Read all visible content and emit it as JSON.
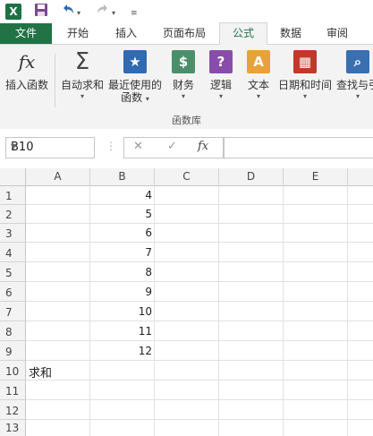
{
  "quick_access": {
    "app_icon": "X",
    "save_icon": "save-icon",
    "undo_icon": "undo-icon",
    "redo_icon": "redo-icon",
    "customize_icon": "customize-icon"
  },
  "tabs": [
    "文件",
    "开始",
    "插入",
    "页面布局",
    "公式",
    "数据",
    "审阅"
  ],
  "active_tab": "公式",
  "ribbon": {
    "insert_function": "插入函数",
    "autosum": "自动求和",
    "recent_line1": "最近使用的",
    "recent_line2": "函数",
    "financial": "财务",
    "logical": "逻辑",
    "text": "文本",
    "datetime": "日期和时间",
    "lookup": "查找与引",
    "group_label": "函数库"
  },
  "formula_bar": {
    "name_box": "B10",
    "fx_label": "fx",
    "formula": ""
  },
  "columns": [
    "A",
    "B",
    "C",
    "D",
    "E"
  ],
  "rows": [
    "1",
    "2",
    "3",
    "4",
    "5",
    "6",
    "7",
    "8",
    "9",
    "10",
    "11",
    "12",
    "13"
  ],
  "cells": {
    "B1": "4",
    "B2": "5",
    "B3": "6",
    "B4": "7",
    "B5": "8",
    "B6": "9",
    "B7": "10",
    "B8": "11",
    "B9": "12",
    "A10": "求和"
  },
  "colors": {
    "excel_green": "#217346",
    "ribbon_bg": "#f3f3f3"
  }
}
